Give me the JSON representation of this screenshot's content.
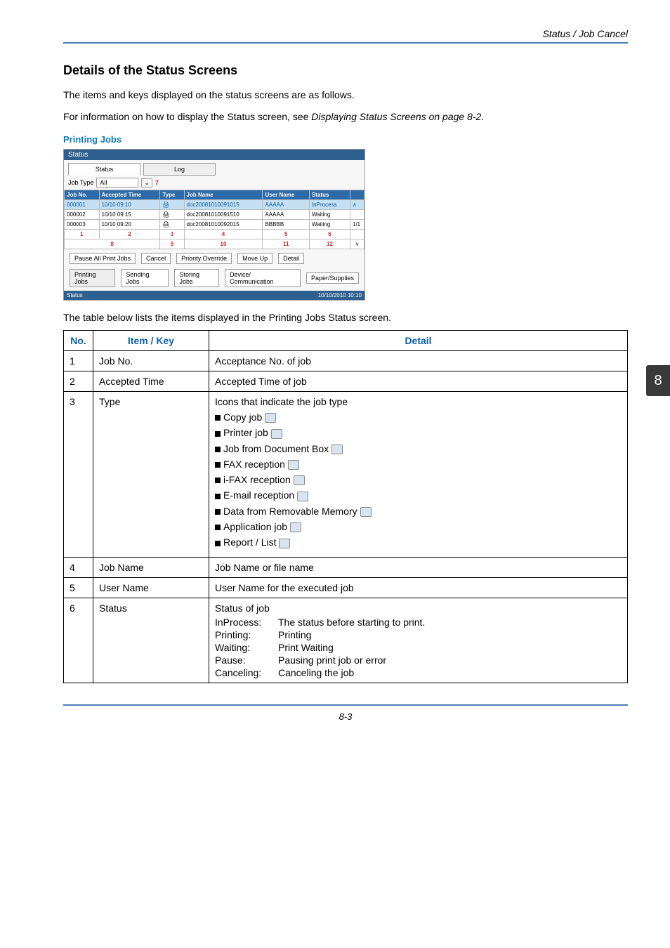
{
  "header": {
    "breadcrumb": "Status / Job Cancel"
  },
  "section": {
    "title": "Details of the Status Screens",
    "p1": "The items and keys displayed on the status screens are as follows.",
    "p2_a": "For information on how to display the Status screen, see ",
    "p2_b": "Displaying Status Screens on page 8-2",
    "p2_c": "."
  },
  "sub": {
    "title": "Printing Jobs"
  },
  "panel": {
    "title": "Status",
    "tab_status": "Status",
    "tab_log": "Log",
    "jobtype_label": "Job Type",
    "jobtype_value": "All",
    "cols": {
      "jobno": "Job No.",
      "accepted": "Accepted Time",
      "type": "Type",
      "jobname": "Job Name",
      "username": "User Name",
      "status": "Status"
    },
    "rows": [
      {
        "no": "000001",
        "time": "10/10 09:10",
        "name": "doc20081010091015",
        "user": "AAAAA",
        "status": "InProcess"
      },
      {
        "no": "000002",
        "time": "10/10 09:15",
        "name": "doc20081010091510",
        "user": "AAAAA",
        "status": "Waiting"
      },
      {
        "no": "000003",
        "time": "10/10 09:20",
        "name": "doc20081010092015",
        "user": "BBBBB",
        "status": "Waiting"
      }
    ],
    "page": "1/1",
    "callouts_a": {
      "c1": "1",
      "c2": "2",
      "c3": "3",
      "c4": "4",
      "c5": "5",
      "c6": "6"
    },
    "callouts_b": {
      "c7": "7",
      "c8": "8",
      "c9": "9",
      "c10": "10",
      "c11": "11",
      "c12": "12"
    },
    "btn_pause": "Pause All Print Jobs",
    "btn_cancel": "Cancel",
    "btn_priority": "Priority Override",
    "btn_moveup": "Move Up",
    "btn_detail": "Detail",
    "tab_printing": "Printing Jobs",
    "tab_sending": "Sending Jobs",
    "tab_storing": "Storing Jobs",
    "tab_device": "Device/ Communication",
    "tab_paper": "Paper/Supplies",
    "footer_left": "Status",
    "footer_right": "10/10/2010  10:10"
  },
  "caption": "The table below lists the items displayed in the Printing Jobs Status screen.",
  "detail": {
    "head": {
      "no": "No.",
      "item": "Item / Key",
      "detail": "Detail"
    },
    "rows": [
      {
        "no": "1",
        "item": "Job No.",
        "detail": "Acceptance No. of job"
      },
      {
        "no": "2",
        "item": "Accepted Time",
        "detail": "Accepted Time of job"
      },
      {
        "no": "3",
        "item": "Type",
        "detail": "Icons that indicate the job type"
      },
      {
        "no": "4",
        "item": "Job Name",
        "detail": "Job Name or file name"
      },
      {
        "no": "5",
        "item": "User Name",
        "detail": "User Name for the executed job"
      },
      {
        "no": "6",
        "item": "Status",
        "detail": "Status of job"
      }
    ],
    "types": {
      "t1": "Copy job",
      "t2": "Printer job",
      "t3": "Job from Document Box",
      "t4": "FAX reception",
      "t5": "i-FAX reception",
      "t6": "E-mail reception",
      "t7": "Data from Removable Memory",
      "t8": "Application job",
      "t9": "Report / List"
    },
    "status_def": {
      "k1": "InProcess:",
      "v1": "The status before starting to print.",
      "k2": "Printing:",
      "v2": "Printing",
      "k3": "Waiting:",
      "v3": "Print Waiting",
      "k4": "Pause:",
      "v4": "Pausing print job or error",
      "k5": "Canceling:",
      "v5": "Canceling the job"
    }
  },
  "chapter": "8",
  "footer": "8-3"
}
